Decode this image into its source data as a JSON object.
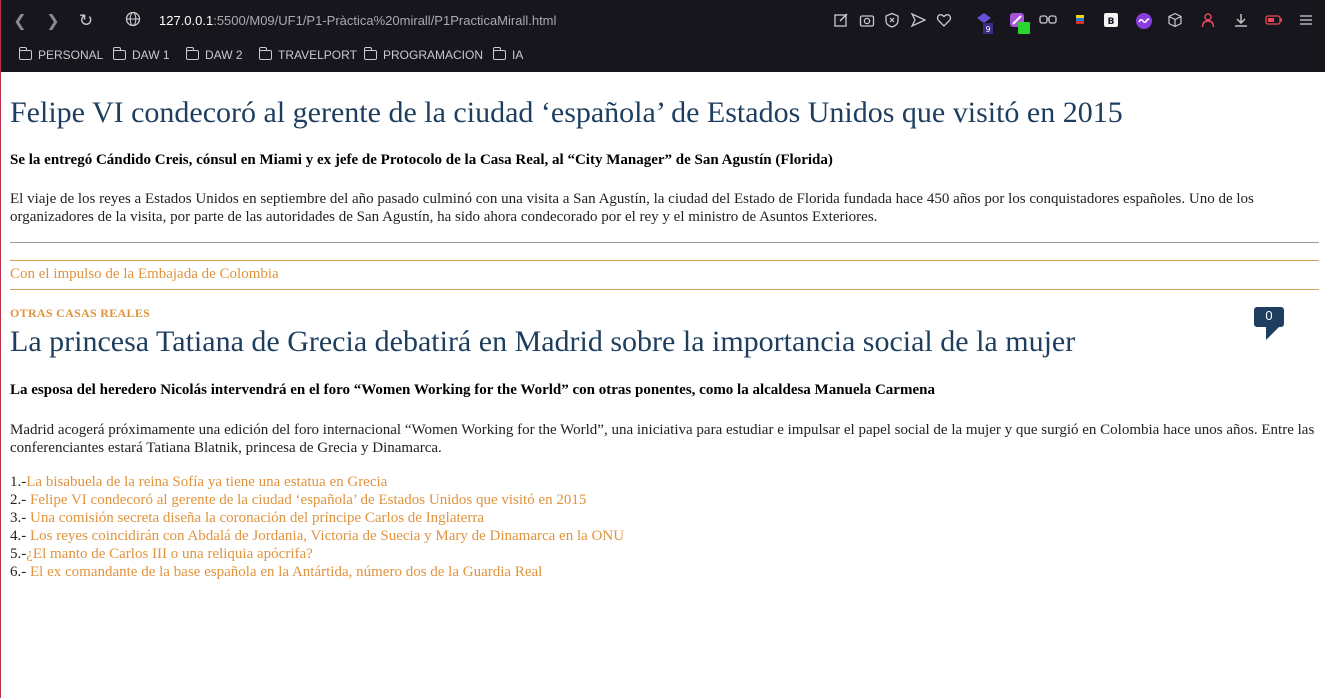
{
  "browser": {
    "url_host": "127.0.0.1",
    "url_path": ":5500/M09/UF1/P1-Pràctica%20mirall/P1PracticaMirall.html",
    "extension_badge": "9",
    "bookmarks": [
      "PERSONAL",
      "DAW 1",
      "DAW 2",
      "TRAVELPORT",
      "PROGRAMACION",
      "IA"
    ]
  },
  "article1": {
    "title": "Felipe VI condecoró al gerente de la ciudad ‘española’ de Estados Unidos que visitó en 2015",
    "subtitle": "Se la entregó Cándido Creis, cónsul en Miami y ex jefe de Protocolo de la Casa Real, al “City Manager” de San Agustín (Florida)",
    "body": "El viaje de los reyes a Estados Unidos en septiembre del año pasado culminó con una visita a San Agustín, la ciudad del Estado de Florida fundada hace 450 años por los conquistadores españoles. Uno de los organizadores de la visita, por parte de las autoridades de San Agustín, ha sido ahora condecorado por el rey y el ministro de Asuntos Exteriores."
  },
  "impulso_link": "Con el impulso de la Embajada de Colombia",
  "article2": {
    "kicker": "OTRAS CASAS REALES",
    "comment_count": "0",
    "title": "La princesa Tatiana de Grecia debatirá en Madrid sobre la importancia social de la mujer",
    "subtitle": "La esposa del heredero Nicolás intervendrá en el foro “Women Working for the World” con otras ponentes, como la alcaldesa Manuela Carmena",
    "body": "Madrid acogerá próximamente una edición del foro internacional “Women Working for the World”, una iniciativa para estudiar e impulsar el papel social de la mujer y que surgió en Colombia hace unos años. Entre las conferenciantes estará Tatiana Blatnik, princesa de Grecia y Dinamarca."
  },
  "related": [
    {
      "num": "1.-",
      "text": "La bisabuela de la reina Sofía ya tiene una estatua en Grecia"
    },
    {
      "num": "2.- ",
      "text": "Felipe VI condecoró al gerente de la ciudad ‘española’ de Estados Unidos que visitó en 2015"
    },
    {
      "num": "3.- ",
      "text": "Una comisión secreta diseña la coronación del príncipe Carlos de Inglaterra"
    },
    {
      "num": "4.- ",
      "text": "Los reyes coincidirán con Abdalá de Jordania, Victoria de Suecia y Mary de Dinamarca en la ONU"
    },
    {
      "num": "5.-",
      "text": "¿El manto de Carlos III o una reliquia apócrifa?"
    },
    {
      "num": "6.- ",
      "text": "El ex comandante de la base española en la Antártida, número dos de la Guardia Real"
    }
  ],
  "colors": {
    "title": "#1d3e5f",
    "link": "#e0943e",
    "chrome_bg": "#17161d"
  }
}
